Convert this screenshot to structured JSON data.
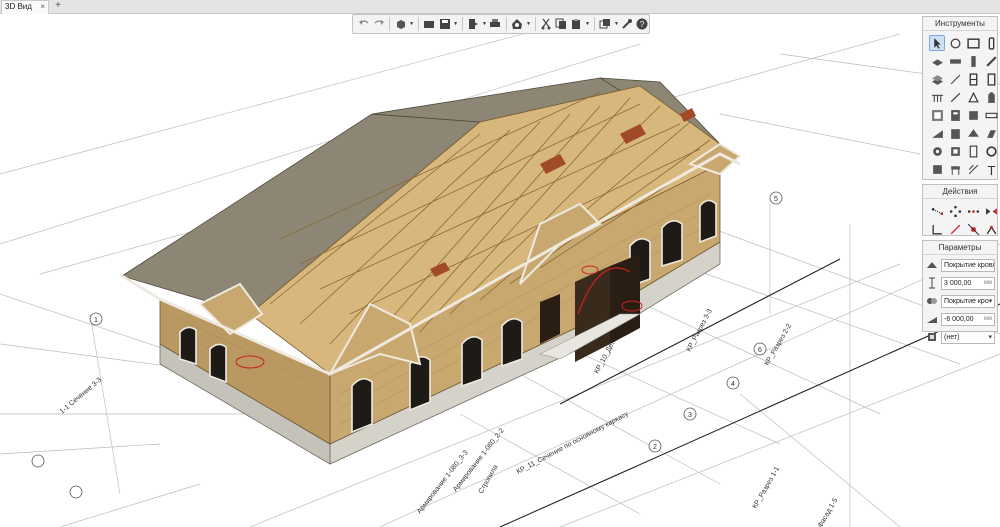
{
  "tabs": [
    {
      "label": "3D Вид",
      "close": "×"
    }
  ],
  "tab_add": "+",
  "toolbar": {
    "buttons": [
      "undo-icon",
      "redo-icon",
      "model-3d-icon",
      "folder-icon",
      "save-icon",
      "export-icon",
      "print-icon",
      "settings-house-icon",
      "cut-icon",
      "copy-icon",
      "paste-icon",
      "views-icon",
      "wrench-icon",
      "help-icon"
    ],
    "help_label": "?"
  },
  "tools_panel": {
    "title": "Инструменты",
    "text_tool_label": "T",
    "tools": [
      "select-icon",
      "rotate-icon",
      "wall-icon",
      "door-icon",
      "slab-icon",
      "column-icon",
      "beam-icon",
      "pencil-icon",
      "stair-icon",
      "line-icon",
      "window-icon",
      "link-icon",
      "railing-icon",
      "measure-icon",
      "dim-icon",
      "paint-icon",
      "room-icon",
      "text-tool-icon",
      "section-icon",
      "ruler-icon",
      "ramp-icon",
      "chimney-icon",
      "roof-icon",
      "skylight-icon",
      "gear-object-icon",
      "block-icon",
      "level-icon",
      "settings-icon",
      "lift-icon",
      "stool-icon",
      "dims-icon",
      "t-icon"
    ]
  },
  "actions_panel": {
    "title": "Действия",
    "actions": [
      "move-points-icon",
      "offset-icon",
      "array-icon",
      "mirror-icon",
      "trim-icon",
      "extend-icon",
      "split-icon",
      "join-icon"
    ]
  },
  "params_panel": {
    "title": "Параметры",
    "rows": [
      {
        "value": "Покрытие кровли",
        "unit": ""
      },
      {
        "value": "3 000,00",
        "unit": "мм"
      },
      {
        "value": "Покрытие кро",
        "unit": ""
      },
      {
        "value": "-6 000,00",
        "unit": "мм"
      },
      {
        "value": "(нет)",
        "unit": ""
      }
    ]
  },
  "model": {
    "labels": [
      "КР_10_Детали",
      "КР_11_Сечение по основному каркасу",
      "КР_Разрез 1-1",
      "КР_Разрез 2-2",
      "КР_Фасад 1-5",
      "КР_Разрез 3-3",
      "Армирование 1-080_2-2",
      "Армирование 1-080_3-3",
      "Стропила",
      "1-1 Сечение 3-3"
    ],
    "axis_numbers": [
      "1",
      "2",
      "3",
      "4",
      "5",
      "6"
    ]
  },
  "colors": {
    "roof": "#8d8674",
    "timber": "#d8b77c",
    "wall": "#c9a870",
    "plinth": "#d3d0c8",
    "trim": "#efeae0",
    "accent_red": "#cc2222"
  }
}
